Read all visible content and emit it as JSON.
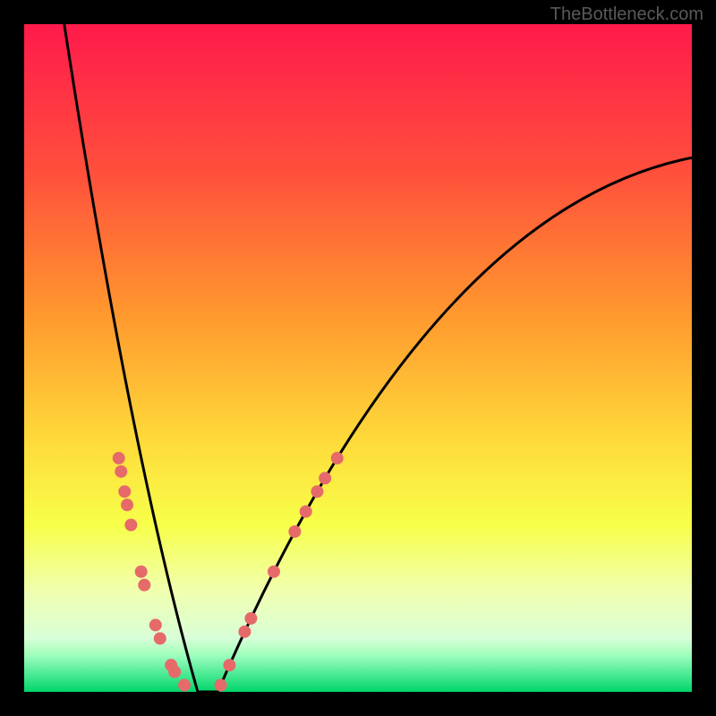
{
  "watermark": "TheBottleneck.com",
  "chart_data": {
    "type": "line",
    "xlim": [
      0,
      100
    ],
    "ylim": [
      0,
      100
    ],
    "curve_vertex_x": 26,
    "left_branch": {
      "x0": 6,
      "y0": 100,
      "x1": 26,
      "y1": 0
    },
    "right_branch": {
      "ctrl_x": 60,
      "ctrl_y": 72,
      "x1": 100,
      "y1": 80
    },
    "dots_left_y": [
      35,
      33,
      30,
      28,
      25,
      18,
      16,
      10,
      8,
      4,
      3,
      1
    ],
    "dots_right_y": [
      1,
      4,
      9,
      11,
      18,
      24,
      27,
      30,
      32,
      35
    ],
    "dot_color": "#e66a6a",
    "dot_radius_px": 7,
    "gradient_stops": [
      [
        0.0,
        "#ff1a4b"
      ],
      [
        0.22,
        "#ff4f3c"
      ],
      [
        0.44,
        "#ff9a2e"
      ],
      [
        0.62,
        "#ffd93a"
      ],
      [
        0.75,
        "#f7ff4a"
      ],
      [
        0.85,
        "#f0ffb0"
      ],
      [
        0.92,
        "#d8ffd8"
      ],
      [
        0.97,
        "#66ff99"
      ],
      [
        1.0,
        "#00d66a"
      ]
    ],
    "green_band": {
      "top_frac": 0.945,
      "bottom_frac": 1.0
    }
  }
}
